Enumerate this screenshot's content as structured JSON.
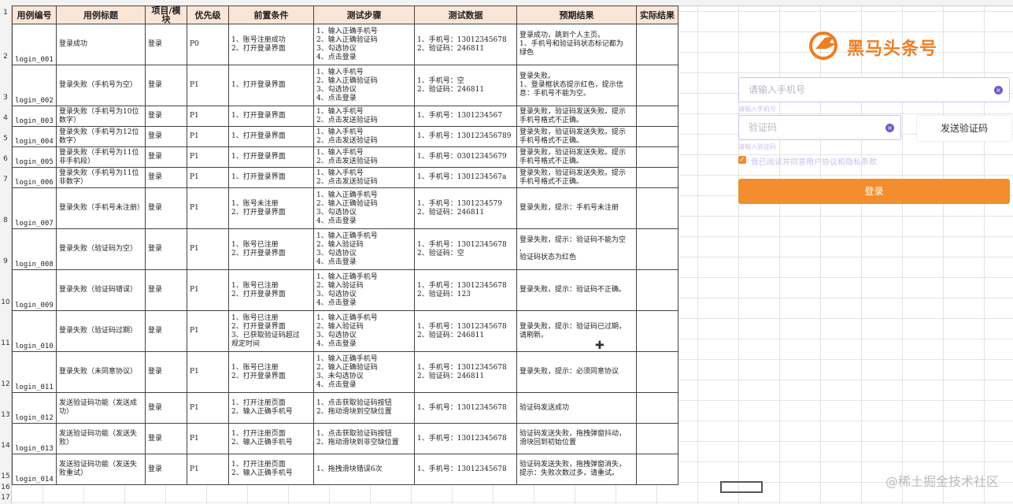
{
  "table": {
    "headers": [
      "用例编号",
      "用例标题",
      "项目/模块",
      "优先级",
      "前置条件",
      "测试步骤",
      "测试数据",
      "预期结果",
      "实际结果"
    ],
    "rows": [
      {
        "id": "login_001",
        "title": "登录成功",
        "module": "登录",
        "priority": "P0",
        "pre": [
          "1、账号注册成功",
          "2、打开登录界面"
        ],
        "steps": [
          "1、输入正确手机号",
          "2、输入正确验证码",
          "3、勾选协议",
          "4、点击登录"
        ],
        "data": [
          "1、手机号：13012345678",
          "2、验证码：246811"
        ],
        "expected": [
          "登录成功，跳到个人主页。",
          "1、手机号和验证码状态标记都为",
          "绿色"
        ],
        "actual": ""
      },
      {
        "id": "login_002",
        "title": "登录失败（手机号为空）",
        "module": "登录",
        "priority": "P1",
        "pre": [
          "1、打开登录界面"
        ],
        "steps": [
          "1、输入手机号",
          "2、输入正确验证码",
          "3、勾选协议",
          "4、点击登录"
        ],
        "data": [
          "1、手机号：空",
          "2、验证码：246811"
        ],
        "expected": [
          "登录失败。",
          "1、登录框状态提示红色，提示信",
          "息：手机号不能为空。"
        ],
        "actual": ""
      },
      {
        "id": "login_003",
        "title": "登录失败（手机号为10位数字）",
        "module": "登录",
        "priority": "P1",
        "pre": [
          "1、打开登录界面"
        ],
        "steps": [
          "1、输入手机号",
          "2、点击发送验证码"
        ],
        "data": [
          "1、手机号：1301234567"
        ],
        "expected": [
          "登录失败，验证码发送失败。提示",
          "手机号格式不正确。"
        ],
        "actual": ""
      },
      {
        "id": "login_004",
        "title": "登录失败（手机号为12位数字）",
        "module": "登录",
        "priority": "P1",
        "pre": [
          "1、打开登录界面"
        ],
        "steps": [
          "1、输入手机号",
          "2、点击发送验证码"
        ],
        "data": [
          "1、手机号：130123456789"
        ],
        "expected": [
          "登录失败，验证码发送失败。提示",
          "手机号格式不正确。"
        ],
        "actual": ""
      },
      {
        "id": "login_005",
        "title": "登录失败（手机号为11位非手机段）",
        "module": "登录",
        "priority": "P1",
        "pre": [
          "1、打开登录界面"
        ],
        "steps": [
          "1、输入手机号",
          "2、点击发送验证码"
        ],
        "data": [
          "1、手机号：03012345679"
        ],
        "expected": [
          "登录失败，验证码发送失败。提示",
          "手机号格式不正确。"
        ],
        "actual": ""
      },
      {
        "id": "login_006",
        "title": "登录失败（手机号为11位非数字）",
        "module": "登录",
        "priority": "P1",
        "pre": [
          "1、打开登录界面"
        ],
        "steps": [
          "1、输入手机号",
          "2、点击发送验证码"
        ],
        "data": [
          "1、手机号：1301234567a"
        ],
        "expected": [
          "登录失败，验证码发送失败。提示",
          "手机号格式不正确。"
        ],
        "actual": ""
      },
      {
        "id": "login_007",
        "title": "登录失败（手机号未注册）",
        "module": "登录",
        "priority": "P1",
        "pre": [
          "1、账号未注册",
          "2、打开登录界面"
        ],
        "steps": [
          "1、输入正确手机号",
          "2、输入正确验证码",
          "3、勾选协议",
          "4、点击登录"
        ],
        "data": [
          "1、手机号：1301234579",
          "2、验证码：246811"
        ],
        "expected": [
          "登录失败，提示：手机号未注册"
        ],
        "actual": ""
      },
      {
        "id": "login_008",
        "title": "登录失败（验证码为空）",
        "module": "登录",
        "priority": "P1",
        "pre": [
          "1、账号已注册",
          "2、打开登录界面"
        ],
        "steps": [
          "1、输入正确手机号",
          "2、输入验证码",
          "3、勾选协议",
          "4、点击登录"
        ],
        "data": [
          "1、手机号：13012345678",
          "2、验证码：空"
        ],
        "expected": [
          "登录失败，提示：验证码不能为空",
          ",",
          "验证码状态为红色"
        ],
        "actual": ""
      },
      {
        "id": "login_009",
        "title": "登录失败（验证码错误）",
        "module": "登录",
        "priority": "P1",
        "pre": [
          "1、账号已注册",
          "2、打开登录界面"
        ],
        "steps": [
          "1、输入正确手机号",
          "2、输入验证码",
          "3、勾选协议",
          "4、点击登录"
        ],
        "data": [
          "1、手机号：13012345678",
          "2、验证码：123"
        ],
        "expected": [
          "登录失败，提示：验证码不正确。"
        ],
        "actual": ""
      },
      {
        "id": "login_010",
        "title": "登录失败（验证码过期）",
        "module": "登录",
        "priority": "P1",
        "pre": [
          "1、账号已注册",
          "2、打开登录界面",
          "3、已获取验证码超过",
          "规定时间"
        ],
        "steps": [
          "1、输入正确手机号",
          "2、输入验证码",
          "3、勾选协议",
          "4、点击登录"
        ],
        "data": [
          "1、手机号：13012345678",
          "2、验证码：246811"
        ],
        "expected": [
          "登录失败，提示：验证码已过期，",
          "请刷新。"
        ],
        "actual": ""
      },
      {
        "id": "login_011",
        "title": "登录失败（未同意协议）",
        "module": "登录",
        "priority": "P1",
        "pre": [
          "1、账号已注册",
          "2、打开登录界面"
        ],
        "steps": [
          "1、输入正确手机号",
          "2、输入正确验证码",
          "3、未勾选协议",
          "4、点击登录"
        ],
        "data": [
          "1、手机号：13012345678",
          "2、验证码：246811"
        ],
        "expected": [
          "登录失败，提示：必须同意协议"
        ],
        "actual": ""
      },
      {
        "id": "login_012",
        "title": "发送验证码功能（发送成功）",
        "module": "登录",
        "priority": "P1",
        "pre": [
          "1、打开注册页面",
          "2、输入正确手机号"
        ],
        "steps": [
          "1、点击获取验证码按钮",
          "2、拖动滑块到空缺位置"
        ],
        "data": [
          "1、手机号：13012345678"
        ],
        "expected": [
          "验证码发送成功"
        ],
        "actual": ""
      },
      {
        "id": "login_013",
        "title": "发送验证码功能（发送失败）",
        "module": "登录",
        "priority": "P1",
        "pre": [
          "1、打开注册页面",
          "2、输入正确手机号"
        ],
        "steps": [
          "1、点击获取验证码按钮",
          "2、拖动滑块到非空缺位置"
        ],
        "data": [
          "1、手机号：13012345678"
        ],
        "expected": [
          "验证码发送失败，拖拽弹窗抖动，",
          "滑块回到初始位置"
        ],
        "actual": ""
      },
      {
        "id": "login_014",
        "title": "发送验证码功能（发送失败重试）",
        "module": "登录",
        "priority": "P1",
        "pre": [
          "1、打开注册页面",
          "2、输入正确手机号"
        ],
        "steps": [
          "1、拖拽滑块错误6次"
        ],
        "data": [
          "1、手机号：13012345678"
        ],
        "expected": [
          "验证码发送失败，拖拽弹窗消失，",
          "提示：失败次数过多，请重试。"
        ],
        "actual": ""
      }
    ]
  },
  "row_numbers": [
    "1",
    "2",
    "3",
    "4",
    "5",
    "6",
    "7",
    "8",
    "9",
    "10",
    "11",
    "12",
    "13",
    "14",
    "15",
    "16",
    "17"
  ],
  "login_panel": {
    "brand_name": "黑马头条号",
    "phone_placeholder": "请输入手机号",
    "phone_hint": "请输入手机号",
    "code_placeholder": "验证码",
    "code_hint": "请输入验证码",
    "send_code_label": "发送验证码",
    "agree_text": "我已阅读并同意用户协议和隐私条款",
    "login_label": "登录",
    "accent_color": "#f28e2e"
  },
  "watermark": "@稀土掘金技术社区"
}
